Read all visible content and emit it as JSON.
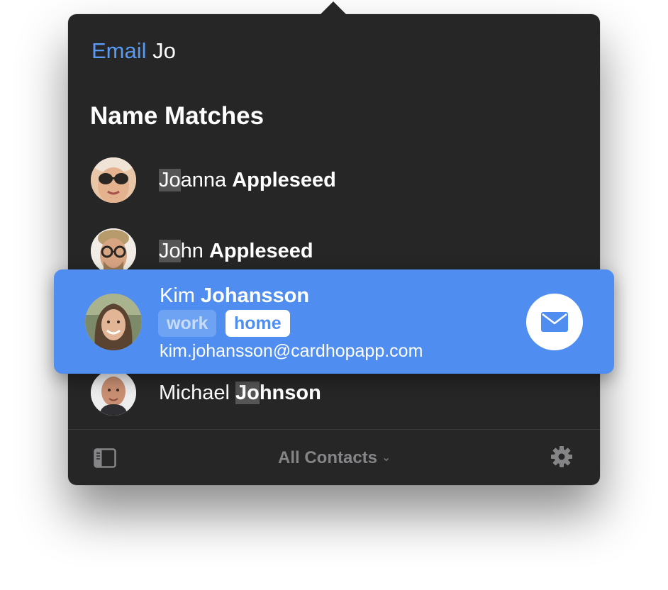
{
  "query": {
    "command": "Email",
    "text": "Jo"
  },
  "section_title": "Name Matches",
  "contacts": [
    {
      "first": "Jo",
      "first_rest": "anna",
      "last": "Appleseed"
    },
    {
      "first": "Jo",
      "first_rest": "hn",
      "last": "Appleseed"
    },
    {
      "first": "Kim",
      "last": "Johansson",
      "labels": [
        "work",
        "home"
      ],
      "selected_label": "home",
      "email": "kim.johansson@cardhopapp.com"
    },
    {
      "first": "Michael",
      "last_hl": "Jo",
      "last_rest": "hnson"
    }
  ],
  "footer": {
    "scope": "All Contacts",
    "chevron": "⌄"
  },
  "icons": {
    "sidebar": "sidebar-icon",
    "settings": "gear-icon",
    "mail": "envelope-icon"
  },
  "colors": {
    "accent": "#4f8ef0",
    "command": "#5a9af3",
    "background": "#262627"
  }
}
